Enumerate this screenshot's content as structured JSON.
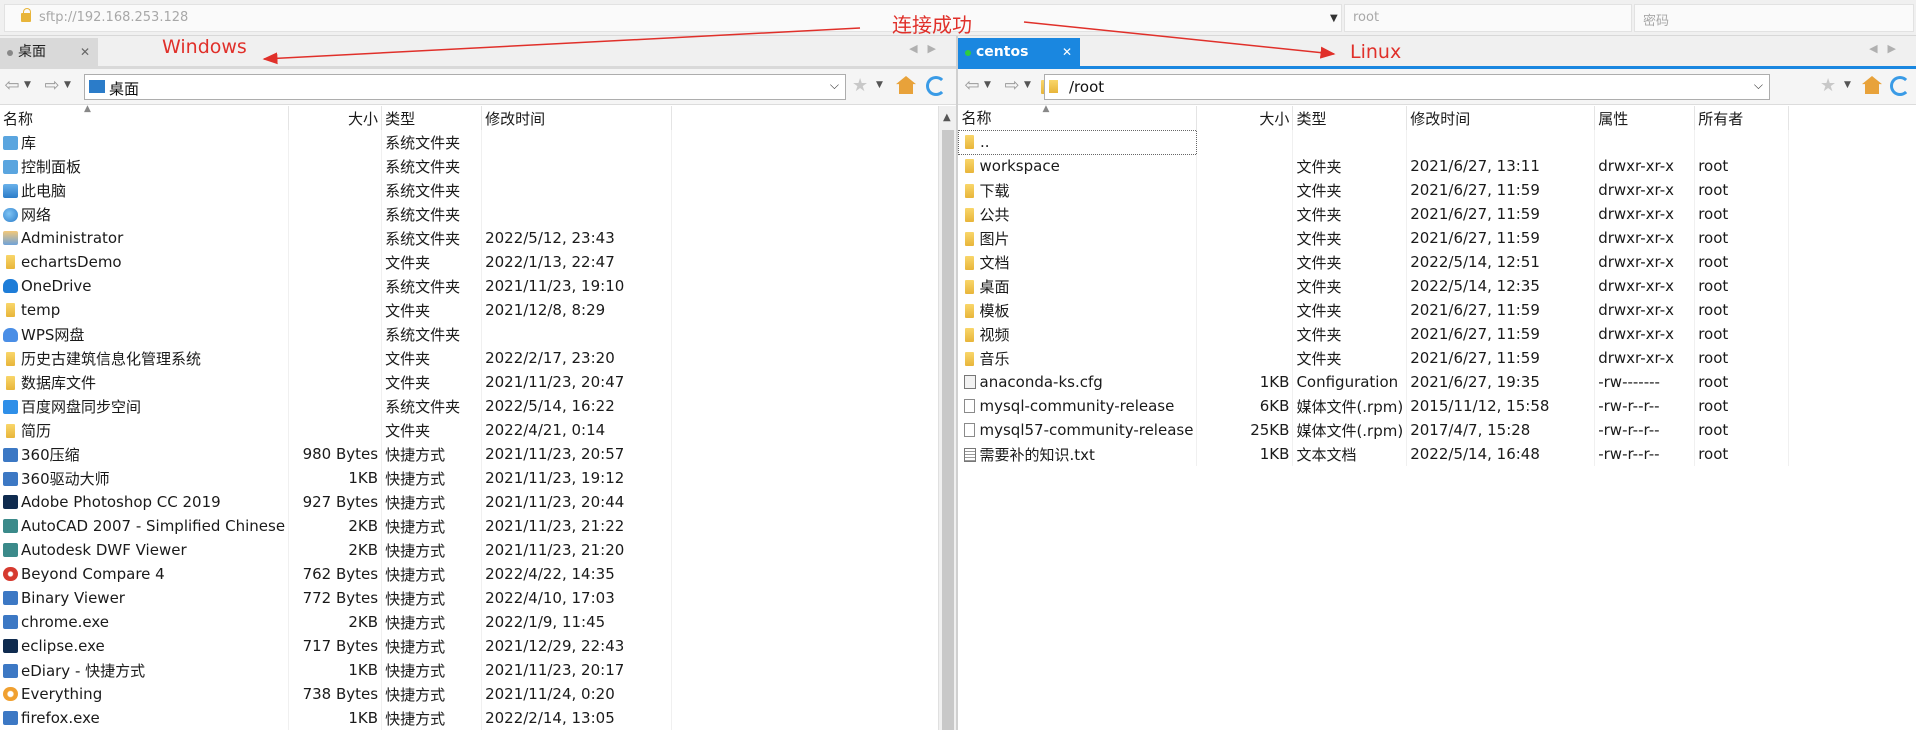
{
  "address": {
    "host": "sftp://192.168.253.128",
    "user": "root",
    "password_placeholder": "密码"
  },
  "annotations": {
    "connected": "连接成功",
    "windows": "Windows",
    "linux": "Linux"
  },
  "colors": {
    "accent": "#1a87e0",
    "annotation": "#e0302a",
    "connected_dot": "#2ecc40"
  },
  "left": {
    "tab_label": "桌面",
    "path": "桌面",
    "columns": [
      "名称",
      "大小",
      "类型",
      "修改时间"
    ],
    "rows": [
      {
        "icon": "library-icon",
        "name": "库",
        "size": "",
        "type": "系统文件夹",
        "modified": ""
      },
      {
        "icon": "control-panel-icon",
        "name": "控制面板",
        "size": "",
        "type": "系统文件夹",
        "modified": ""
      },
      {
        "icon": "computer-icon",
        "name": "此电脑",
        "size": "",
        "type": "系统文件夹",
        "modified": ""
      },
      {
        "icon": "network-icon",
        "name": "网络",
        "size": "",
        "type": "系统文件夹",
        "modified": ""
      },
      {
        "icon": "user-icon",
        "name": "Administrator",
        "size": "",
        "type": "系统文件夹",
        "modified": "2022/5/12, 23:43"
      },
      {
        "icon": "folder-icon",
        "name": "echartsDemo",
        "size": "",
        "type": "文件夹",
        "modified": "2022/1/13, 22:47"
      },
      {
        "icon": "onedrive-icon",
        "name": "OneDrive",
        "size": "",
        "type": "系统文件夹",
        "modified": "2021/11/23, 19:10"
      },
      {
        "icon": "folder-icon",
        "name": "temp",
        "size": "",
        "type": "文件夹",
        "modified": "2021/12/8, 8:29"
      },
      {
        "icon": "wps-cloud-icon",
        "name": "WPS网盘",
        "size": "",
        "type": "系统文件夹",
        "modified": ""
      },
      {
        "icon": "folder-icon",
        "name": "历史古建筑信息化管理系统",
        "size": "",
        "type": "文件夹",
        "modified": "2022/2/17, 23:20"
      },
      {
        "icon": "folder-icon",
        "name": "数据库文件",
        "size": "",
        "type": "文件夹",
        "modified": "2021/11/23, 20:47"
      },
      {
        "icon": "baidu-netdisk-icon",
        "name": "百度网盘同步空间",
        "size": "",
        "type": "系统文件夹",
        "modified": "2022/5/14, 16:22"
      },
      {
        "icon": "folder-icon",
        "name": "简历",
        "size": "",
        "type": "文件夹",
        "modified": "2022/4/21, 0:14"
      },
      {
        "icon": "app-shortcut-icon",
        "name": "360压缩",
        "size": "980 Bytes",
        "type": "快捷方式",
        "modified": "2021/11/23, 20:57"
      },
      {
        "icon": "app-shortcut-icon",
        "name": "360驱动大师",
        "size": "1KB",
        "type": "快捷方式",
        "modified": "2021/11/23, 19:12"
      },
      {
        "icon": "photoshop-icon",
        "name": "Adobe Photoshop CC 2019",
        "size": "927 Bytes",
        "type": "快捷方式",
        "modified": "2021/11/23, 20:44"
      },
      {
        "icon": "autocad-icon",
        "name": "AutoCAD 2007 - Simplified Chinese",
        "size": "2KB",
        "type": "快捷方式",
        "modified": "2021/11/23, 21:22"
      },
      {
        "icon": "autodesk-icon",
        "name": "Autodesk DWF Viewer",
        "size": "2KB",
        "type": "快捷方式",
        "modified": "2021/11/23, 21:20"
      },
      {
        "icon": "beyond-compare-icon",
        "name": "Beyond Compare 4",
        "size": "762 Bytes",
        "type": "快捷方式",
        "modified": "2022/4/22, 14:35"
      },
      {
        "icon": "binary-viewer-icon",
        "name": "Binary Viewer",
        "size": "772 Bytes",
        "type": "快捷方式",
        "modified": "2022/4/10, 17:03"
      },
      {
        "icon": "chrome-icon",
        "name": "chrome.exe",
        "size": "2KB",
        "type": "快捷方式",
        "modified": "2022/1/9, 11:45"
      },
      {
        "icon": "eclipse-icon",
        "name": "eclipse.exe",
        "size": "717 Bytes",
        "type": "快捷方式",
        "modified": "2021/12/29, 22:43"
      },
      {
        "icon": "ediary-icon",
        "name": "eDiary - 快捷方式",
        "size": "1KB",
        "type": "快捷方式",
        "modified": "2021/11/23, 20:17"
      },
      {
        "icon": "everything-icon",
        "name": "Everything",
        "size": "738 Bytes",
        "type": "快捷方式",
        "modified": "2021/11/24, 0:20"
      },
      {
        "icon": "firefox-icon",
        "name": "firefox.exe",
        "size": "1KB",
        "type": "快捷方式",
        "modified": "2022/2/14, 13:05"
      }
    ]
  },
  "right": {
    "tab_label": "centos",
    "path": "/root",
    "columns": [
      "名称",
      "大小",
      "类型",
      "修改时间",
      "属性",
      "所有者"
    ],
    "rows": [
      {
        "icon": "folder-icon",
        "name": "..",
        "size": "",
        "type": "",
        "modified": "",
        "perm": "",
        "owner": ""
      },
      {
        "icon": "folder-icon",
        "name": "workspace",
        "size": "",
        "type": "文件夹",
        "modified": "2021/6/27, 13:11",
        "perm": "drwxr-xr-x",
        "owner": "root"
      },
      {
        "icon": "folder-icon",
        "name": "下载",
        "size": "",
        "type": "文件夹",
        "modified": "2021/6/27, 11:59",
        "perm": "drwxr-xr-x",
        "owner": "root"
      },
      {
        "icon": "folder-icon",
        "name": "公共",
        "size": "",
        "type": "文件夹",
        "modified": "2021/6/27, 11:59",
        "perm": "drwxr-xr-x",
        "owner": "root"
      },
      {
        "icon": "folder-icon",
        "name": "图片",
        "size": "",
        "type": "文件夹",
        "modified": "2021/6/27, 11:59",
        "perm": "drwxr-xr-x",
        "owner": "root"
      },
      {
        "icon": "folder-icon",
        "name": "文档",
        "size": "",
        "type": "文件夹",
        "modified": "2022/5/14, 12:51",
        "perm": "drwxr-xr-x",
        "owner": "root"
      },
      {
        "icon": "folder-icon",
        "name": "桌面",
        "size": "",
        "type": "文件夹",
        "modified": "2022/5/14, 12:35",
        "perm": "drwxr-xr-x",
        "owner": "root"
      },
      {
        "icon": "folder-icon",
        "name": "模板",
        "size": "",
        "type": "文件夹",
        "modified": "2021/6/27, 11:59",
        "perm": "drwxr-xr-x",
        "owner": "root"
      },
      {
        "icon": "folder-icon",
        "name": "视频",
        "size": "",
        "type": "文件夹",
        "modified": "2021/6/27, 11:59",
        "perm": "drwxr-xr-x",
        "owner": "root"
      },
      {
        "icon": "folder-icon",
        "name": "音乐",
        "size": "",
        "type": "文件夹",
        "modified": "2021/6/27, 11:59",
        "perm": "drwxr-xr-x",
        "owner": "root"
      },
      {
        "icon": "config-file-icon",
        "name": "anaconda-ks.cfg",
        "size": "1KB",
        "type": "Configuration",
        "modified": "2021/6/27, 19:35",
        "perm": "-rw-------",
        "owner": "root"
      },
      {
        "icon": "file-icon",
        "name": "mysql-community-release",
        "size": "6KB",
        "type": "媒体文件(.rpm)",
        "modified": "2015/11/12, 15:58",
        "perm": "-rw-r--r--",
        "owner": "root"
      },
      {
        "icon": "file-icon",
        "name": "mysql57-community-release",
        "size": "25KB",
        "type": "媒体文件(.rpm)",
        "modified": "2017/4/7, 15:28",
        "perm": "-rw-r--r--",
        "owner": "root"
      },
      {
        "icon": "text-file-icon",
        "name": "需要补的知识.txt",
        "size": "1KB",
        "type": "文本文档",
        "modified": "2022/5/14, 16:48",
        "perm": "-rw-r--r--",
        "owner": "root"
      }
    ]
  }
}
